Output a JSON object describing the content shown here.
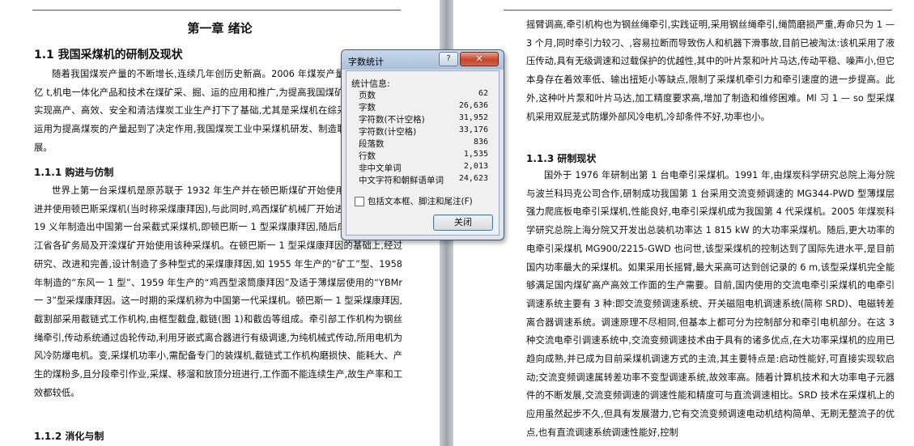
{
  "left_page": {
    "chapter_title": "第一章 绪论",
    "section_title": "1.1 我国采煤机的研制及现状",
    "para1": "随着我国煤炭产量的不断增长,连续几年创历史新高。2006 年煤炭产量已达到 23.25 亿 t,机电一体化产品和技术在煤矿采、掘、运的应用和推广,为提高我国煤矿的生产能力,为实现高产、高效、安全和清洁煤炭工业生产打下了基础,尤其是采煤机在综采技术中的成功运用为提高煤炭的产量起到了决定作用,我国煤炭工业中采煤机研发、制造取得了飞速的发展。",
    "subsection1": "1.1.1 购进与仿制",
    "para2": "世界上第一台采煤机是原苏联于 1932 年生产并在顿巴斯煤矿开始使用的,1952 年购进并使用顿巴斯采煤机(当时称采煤康拜因),与此同时,鸡西煤矿机械厂开始进行仿制工作,于 19 义年制造出中国第一台采截式采煤机,即顿巴斯一 1 型采煤康拜因,随后成批生产。黑龙江省各矿务局及开滦煤矿开始使用该种采煤机。在顿巴斯一 1 型采煤康拜因的基础上,经过研究、改进和完善,设计制造了多种型式的采煤康拜因,如 1955 年生产的“矿工”型、1958 年制造的“东风一 1 型”、1959 年生产的“鸡西型滚筒康拜因”及适于薄煤层使用的“YBMr 一 3”型采煤康拜因。这一时期的采煤机称为中国第一代采煤机。顿巴斯一 1 型采煤康拜因,截割部采用截链式工作机构,由框型截盘,截链(图 1)和截齿等组成。牵引部工作机构为钢丝绳牵引,传动系统通过齿轮传动,利用牙嵌式离合器进行有级调速,为纯机械式传动,所用电机为风冷防爆电机。变,采煤机功率小,需配备专门的装煤机,截链式工作机构磨损快、能耗大、产生的煤粉多,且分段牵引作业,采煤、移溜和放顶分班进行,工作面不能连续生产,故生产率和工效都较低。",
    "subsection2": "1.1.2 消化与制"
  },
  "right_page": {
    "para1": "摇臂调高,牵引机构也为钢丝绳牵引,实践证明,采用钢丝绳牵引,绳筒磨损严重,寿命只为 1 — 3 个月,同时牵引力较刁、,容易拉断而导致伤人和机器下滑事故,目前已被淘汰:该机采用了液压传动,具有无级调速和过载保护的优越性,其中的叶片泵和叶片马达,传动平稳、噪声小,但它本身存在着效率低、输出扭矩小等缺点,限制了采煤机牵引力和牵引速度的进一步提高。此外,这种叶片泵和叶片马达,加工精度要求高,增加了制造和维修困难。Ml 习 1 — so 型采煤机采用双屁茏式防爆外部风冷电机,冷却条件不好,功率也小。",
    "subsection": "1.1.3 研制现状",
    "para2": "国外于 1976 年研制出第 1 台电牵引采煤机。1991 年,由煤炭科学研究总院上海分院与波兰科玛克公司合作,研制成功我国第 1 台采用交流变频调速的 MG344-PWD 型薄煤层强力爬底板电牵引采煤机,性能良好,电牵引采煤机成为我国第 4 代采煤机。2005 年煤炭科学研究总院上海分院又开发出总装机功率达 1 815 kW 的大功率采煤机。随后,更大功率的电牵引采煤机 MG900/2215-GWD 也问世,该型采煤机的控制达到了国际先进水平,是目前国内功率最大的采煤机。如果采用长摇臂,最大采高可达到创记录的 6 m,该型采煤机完全能够满足国内煤矿高产高效工作面的生产需要。目前,国内使用的交流电牵引采煤机的电牵引调速系统主要有 3 种:即交流变频调速系统、开关磁阻电机调速系统(简称 SRD)、电磁转差离合器调速系统。调速原理不尽相同,但基本上都可分为控制部分和牵引电机部分。在这 3 种交流电牵引调速系统中,交流变频调速技术由于具有的诸多优点,在大功率采煤机的应用已趋向成熟,并已成为目前采煤机调速方式的主流,其主要特点是:启动性能好,可直接实现软启动;交流变频调速属转差功率不变型调速系统,故效率高。随着计算机技术和大功率电子元器件的不断发展,交流变频调速的调速性能和精度可与直流调速相比。SRD 技术在采煤机上的应用虽然起步不久,但具有发展潜力,它有交流变频调速电动机结构简单、无刷无整流子的优点,也有直流调速系统调速性能好,控制"
  },
  "dialog": {
    "title": "字数统计",
    "help_label": "?",
    "close_x_label": "✕",
    "stats_label": "统计信息:",
    "stats": [
      {
        "label": "页数",
        "value": "62"
      },
      {
        "label": "字数",
        "value": "26,636"
      },
      {
        "label": "字符数(不计空格)",
        "value": "31,952"
      },
      {
        "label": "字符数(计空格)",
        "value": "33,176"
      },
      {
        "label": "段落数",
        "value": "836"
      },
      {
        "label": "行数",
        "value": "1,535"
      },
      {
        "label": "非中文单词",
        "value": "2,013"
      },
      {
        "label": "中文字符和朝鲜语单词",
        "value": "24,623"
      }
    ],
    "include_checkbox_label": "包括文本框、脚注和尾注(F)",
    "include_checked": false,
    "close_button_label": "关闭"
  }
}
